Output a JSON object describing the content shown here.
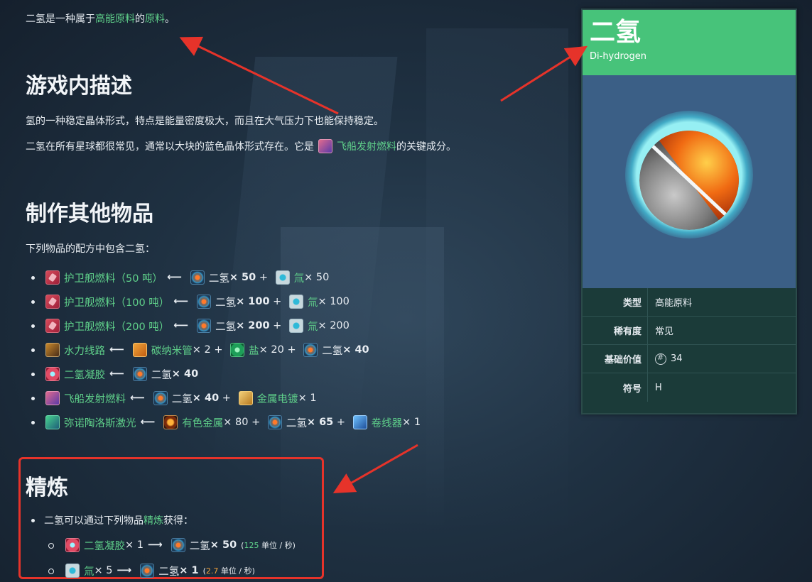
{
  "intro": {
    "prefix": "二氢是一种属于",
    "link1": "高能原料",
    "mid": "的",
    "link2": "原料",
    "suffix": "。"
  },
  "sections": {
    "description": "游戏内描述",
    "crafting": "制作其他物品",
    "refining": "精炼"
  },
  "description": {
    "line1": "氢的一种稳定晶体形式，特点是能量密度极大，而且在大气压力下也能保持稳定。",
    "line2_prefix": "二氢在所有星球都很常见，通常以大块的蓝色晶体形式存在。它是",
    "line2_link": "飞船发射燃料",
    "line2_suffix": "的关键成分。"
  },
  "crafting": {
    "intro": "下列物品的配方中包含二氢：",
    "recipes": [
      {
        "icon": "frigate-fuel-icon",
        "name": "护卫舰燃料（50 吨）",
        "inputs": [
          {
            "icon": "dihydrogen-icon",
            "name": "二氢",
            "qty": "× 50",
            "bold": true,
            "link": false
          },
          {
            "icon": "tritium-icon",
            "name": "氚",
            "qty": "× 50",
            "bold": false,
            "link": true
          }
        ]
      },
      {
        "icon": "frigate-fuel-icon",
        "name": "护卫舰燃料（100 吨）",
        "inputs": [
          {
            "icon": "dihydrogen-icon",
            "name": "二氢",
            "qty": "× 100",
            "bold": true,
            "link": false
          },
          {
            "icon": "tritium-icon",
            "name": "氚",
            "qty": "× 100",
            "bold": false,
            "link": true
          }
        ]
      },
      {
        "icon": "frigate-fuel-icon",
        "name": "护卫舰燃料（200 吨）",
        "inputs": [
          {
            "icon": "dihydrogen-icon",
            "name": "二氢",
            "qty": "× 200",
            "bold": true,
            "link": false
          },
          {
            "icon": "tritium-icon",
            "name": "氚",
            "qty": "× 200",
            "bold": false,
            "link": true
          }
        ]
      },
      {
        "icon": "hydraulic-wiring-icon",
        "name": "水力线路",
        "inputs": [
          {
            "icon": "carbon-nanotube-icon",
            "name": "碳纳米管",
            "qty": "× 2",
            "bold": false,
            "link": true
          },
          {
            "icon": "salt-icon",
            "name": "盐",
            "qty": "× 20",
            "bold": false,
            "link": true
          },
          {
            "icon": "dihydrogen-icon",
            "name": "二氢",
            "qty": "× 40",
            "bold": true,
            "link": false
          }
        ]
      },
      {
        "icon": "dihydrogen-jelly-icon",
        "name": "二氢凝胶",
        "inputs": [
          {
            "icon": "dihydrogen-icon",
            "name": "二氢",
            "qty": "× 40",
            "bold": true,
            "link": false
          }
        ]
      },
      {
        "icon": "starship-launch-fuel-icon",
        "name": "飞船发射燃料",
        "inputs": [
          {
            "icon": "dihydrogen-icon",
            "name": "二氢",
            "qty": "× 40",
            "bold": true,
            "link": false
          },
          {
            "icon": "metal-plating-icon",
            "name": "金属电镀",
            "qty": "× 1",
            "bold": false,
            "link": true
          }
        ]
      },
      {
        "icon": "mino-laser-icon",
        "name": "弥诺陶洛斯激光",
        "inputs": [
          {
            "icon": "chromatic-metal-icon",
            "name": "有色金属",
            "qty": "× 80",
            "bold": false,
            "link": true
          },
          {
            "icon": "dihydrogen-icon",
            "name": "二氢",
            "qty": "× 65",
            "bold": true,
            "link": false
          },
          {
            "icon": "wiring-loom-icon",
            "name": "卷线器",
            "qty": "× 1",
            "bold": false,
            "link": true
          }
        ]
      }
    ]
  },
  "refining": {
    "intro_prefix": "二氢可以通过下列物品",
    "intro_link": "精炼",
    "intro_suffix": "获得：",
    "items": [
      {
        "input": "二氢凝胶",
        "input_qty": "× 1",
        "output": "二氢",
        "output_qty": "× 50",
        "rate": "125",
        "rate_unit": "单位 / 秒",
        "rate_color": "green"
      },
      {
        "input": "氚",
        "input_qty": "× 5",
        "output": "二氢",
        "output_qty": "× 1",
        "rate": "2.7",
        "rate_unit": "单位 / 秒",
        "rate_color": "orange"
      }
    ]
  },
  "infobox": {
    "title": "二氢",
    "subtitle": "Di-hydrogen",
    "rows": [
      {
        "label": "类型",
        "value": "高能原料"
      },
      {
        "label": "稀有度",
        "value": "常见"
      },
      {
        "label": "基础价值",
        "value": "34",
        "icon": "units-coin-icon"
      },
      {
        "label": "符号",
        "value": "H"
      }
    ]
  },
  "colors": {
    "link": "#5fd08a",
    "header_green": "#47c37a",
    "infobox_bg": "#1b3b39",
    "annotation_red": "#e6332a"
  }
}
